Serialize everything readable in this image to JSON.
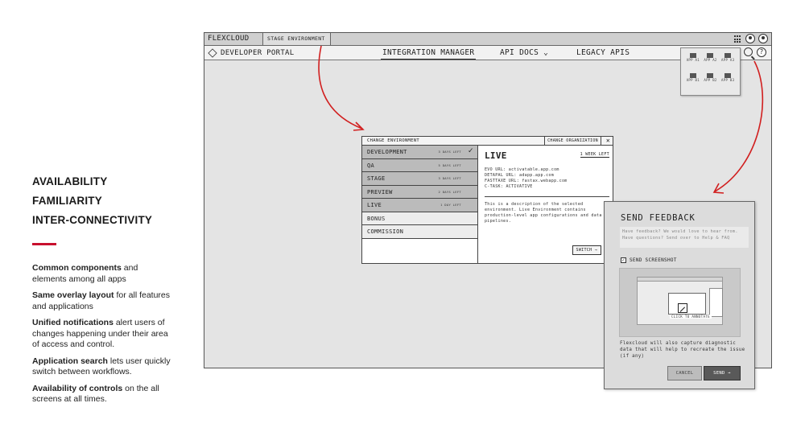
{
  "left_panel": {
    "headings": [
      "AVAILABILITY",
      "FAMILIARITY",
      "INTER-CONNECTIVITY"
    ],
    "bullets": [
      {
        "bold": "Common components",
        "rest": " and elements among all apps"
      },
      {
        "bold": "Same overlay layout",
        "rest": " for all features and applications"
      },
      {
        "bold": "Unified notifications",
        "rest": " alert users of changes happening under their area of access and control."
      },
      {
        "bold": "Application search",
        "rest": " lets user quickly switch between workflows."
      },
      {
        "bold": "Availability of controls",
        "rest": " on the all screens at all times."
      }
    ]
  },
  "window": {
    "brand": "FLEXCLOUD",
    "env_tab": "STAGE ENVIRONMENT",
    "portal": "DEVELOPER PORTAL",
    "nav": {
      "integration": "INTEGRATION MANAGER",
      "api_docs": "API DOCS ⌄",
      "legacy": "LEGACY APIS"
    }
  },
  "apps_menu": {
    "items": [
      "APP A1",
      "APP A2",
      "APP A3",
      "APP B1",
      "APP B2",
      "APP B3"
    ]
  },
  "env_modal": {
    "title": "CHANGE ENVIRONMENT",
    "org_button": "CHANGE ORGANIZATION",
    "close": "✕",
    "environments": [
      {
        "name": "DEVELOPMENT",
        "meta": "3 DAYS LEFT",
        "check": "✓"
      },
      {
        "name": "QA",
        "meta": "5 DAYS LEFT",
        "check": ""
      },
      {
        "name": "STAGE",
        "meta": "3 DAYS LEFT",
        "check": ""
      },
      {
        "name": "PREVIEW",
        "meta": "2 DAYS LEFT",
        "check": ""
      },
      {
        "name": "LIVE",
        "meta": "1 DAY LEFT",
        "check": ""
      },
      {
        "name": "BONUS",
        "meta": "",
        "check": ""
      },
      {
        "name": "COMMISSION",
        "meta": "",
        "check": ""
      }
    ],
    "detail": {
      "title": "LIVE",
      "time_left": "1 WEEK LEFT",
      "urls": [
        "EVO URL: activatable.app.com",
        "DETAPAL URL: adapp.app.com",
        "FASTTAXE URL: fastax.webapp.com",
        "C-TASK: ACTIVATIVE"
      ],
      "description": "This is a description of the selected environment. Live Environment contains production-level app configurations and data pipelines.",
      "switch": "SWITCH →"
    }
  },
  "feedback": {
    "title": "SEND FEEDBACK",
    "placeholder": "Have feedback? We would love to hear from. Have questions? Send over to Help & FAQ",
    "checkbox": "SEND SCREENSHOT",
    "checkbox_mark": "✓",
    "caption": "CLICK TO ANNOTATE",
    "note": "Flexcloud will also capture diagnostic data that will help to recreate the issue (if any)",
    "cancel": "CANCEL",
    "send": "SEND →"
  },
  "colors": {
    "accent_red": "#c8102e",
    "arrow_red": "#d11f1f"
  }
}
